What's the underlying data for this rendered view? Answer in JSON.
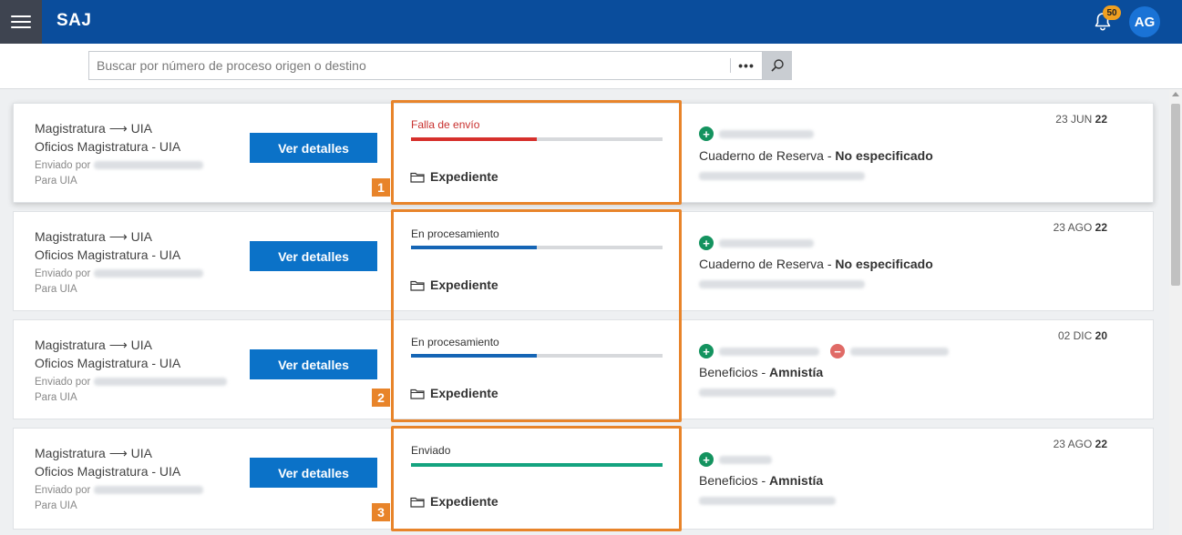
{
  "app": {
    "title": "SAJ",
    "notifications": "50",
    "user_initials": "AG"
  },
  "search": {
    "placeholder": "Buscar por número de proceso origen o destino",
    "more_label": "•••"
  },
  "icons": {
    "menu": "hamburger-menu-icon",
    "bell": "bell-icon",
    "search": "magnifier-icon",
    "folder": "folder-icon",
    "add": "plus-circle-icon",
    "remove": "minus-circle-icon"
  },
  "colors": {
    "topbar": "#0a4d9c",
    "error": "#c8302e",
    "processing": "#1565b5",
    "sent": "#14a37f",
    "highlight": "#e8842a",
    "button": "#0b72c8"
  },
  "cards": [
    {
      "route": "Magistratura ⟶ UIA",
      "subtitle": "Oficios Magistratura - UIA",
      "sent_by_label": "Enviado por",
      "para": "Para UIA",
      "button": "Ver detalles",
      "status": "Falla de envío",
      "progress": 0.5,
      "expediente": "Expediente",
      "case_type": "Cuaderno de Reserva - ",
      "case_value": "No especificado",
      "date_day_month": "23 JUN ",
      "date_year": "22"
    },
    {
      "route": "Magistratura ⟶ UIA",
      "subtitle": "Oficios Magistratura - UIA",
      "sent_by_label": "Enviado por",
      "para": "Para UIA",
      "button": "Ver detalles",
      "status": "En procesamiento",
      "progress": 0.5,
      "expediente": "Expediente",
      "case_type": "Cuaderno de Reserva - ",
      "case_value": "No especificado",
      "date_day_month": "23 AGO ",
      "date_year": "22"
    },
    {
      "route": "Magistratura ⟶ UIA",
      "subtitle": "Oficios Magistratura - UIA",
      "sent_by_label": "Enviado por",
      "para": "Para UIA",
      "button": "Ver detalles",
      "status": "En procesamiento",
      "progress": 0.5,
      "expediente": "Expediente",
      "case_type": "Beneficios - ",
      "case_value": "Amnistía",
      "date_day_month": "02 DIC ",
      "date_year": "20"
    },
    {
      "route": "Magistratura ⟶ UIA",
      "subtitle": "Oficios Magistratura - UIA",
      "sent_by_label": "Enviado por",
      "para": "Para UIA",
      "button": "Ver detalles",
      "status": "Enviado",
      "progress": 1.0,
      "expediente": "Expediente",
      "case_type": "Beneficios - ",
      "case_value": "Amnistía",
      "date_day_month": "23 AGO ",
      "date_year": "22"
    }
  ],
  "callouts": [
    "1",
    "2",
    "3"
  ]
}
